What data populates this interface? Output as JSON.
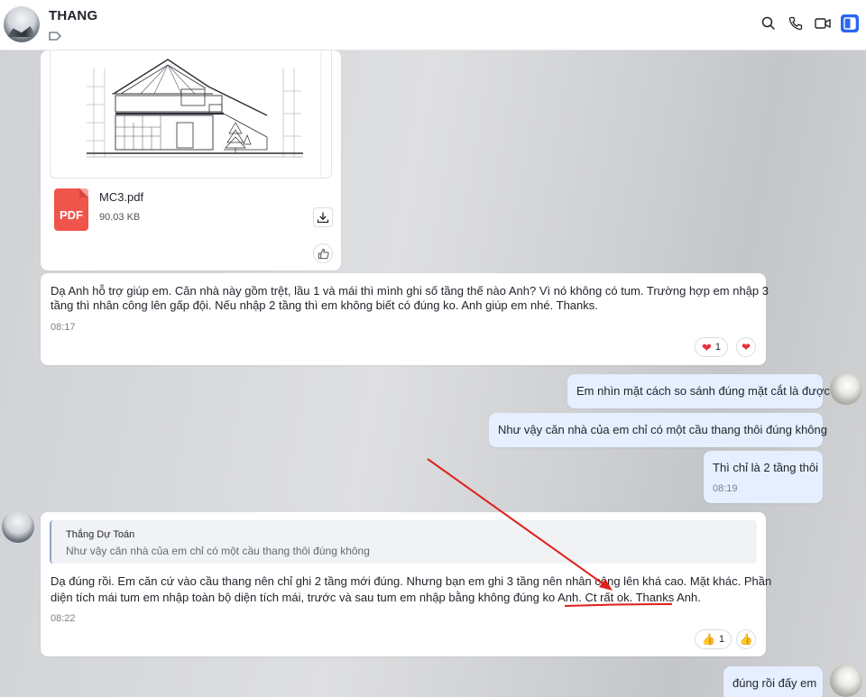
{
  "header": {
    "contact_name": "THANG",
    "icons": [
      "search-icon",
      "phone-icon",
      "video-icon",
      "sidebar-icon"
    ],
    "accent": "#2a67f2"
  },
  "file_message": {
    "file_name": "MC3.pdf",
    "file_size": "90.03 KB",
    "file_type_label": "PDF"
  },
  "messages": {
    "m1": {
      "line1": "Dạ Anh hỗ trợ giúp em. Căn nhà này gồm trệt, lầu 1 và mái thì mình ghi số tầng thế nào Anh? Vì nó không có tum. Trường hợp em nhập 3",
      "line2": "tầng thì nhân công lên gấp đội. Nếu nhập 2 tầng thì em không biết có đúng ko. Anh giúp em nhé. Thanks.",
      "time": "08:17",
      "reaction_count": "1"
    },
    "m2": {
      "text": "Em nhìn mặt cách so sánh đúng mặt cắt là được"
    },
    "m3": {
      "text": "Như vậy căn nhà của em chỉ có một cầu thang thôi đúng không"
    },
    "m4": {
      "text": "Thì chỉ là 2 tầng thôi",
      "time": "08:19"
    },
    "m5": {
      "quote_name": "Thắng Dự Toán",
      "quote_text": "Như vậy căn nhà của em chỉ có một cầu thang thôi đúng không",
      "line1": "Dạ đúng rồi. Em căn cứ vào cầu thang nên chỉ ghi 2 tầng mới đúng. Nhưng bạn em ghi 3 tầng nên nhân công lên khá cao. Mặt khác. Phần",
      "line2_a": "diện tích mái tum em nhập toàn bộ diện tích mái, trước và sau tum em nhập bằng không đúng ko Anh. ",
      "line2_b": "Ct rất ok. Thanks Anh.",
      "time": "08:22",
      "reaction_count": "1"
    },
    "m6": {
      "text": "đúng rồi đấy em"
    }
  },
  "colors": {
    "annotation_red": "#e0201b",
    "heart": "#e8323c",
    "own_bubble": "#e5efff"
  }
}
